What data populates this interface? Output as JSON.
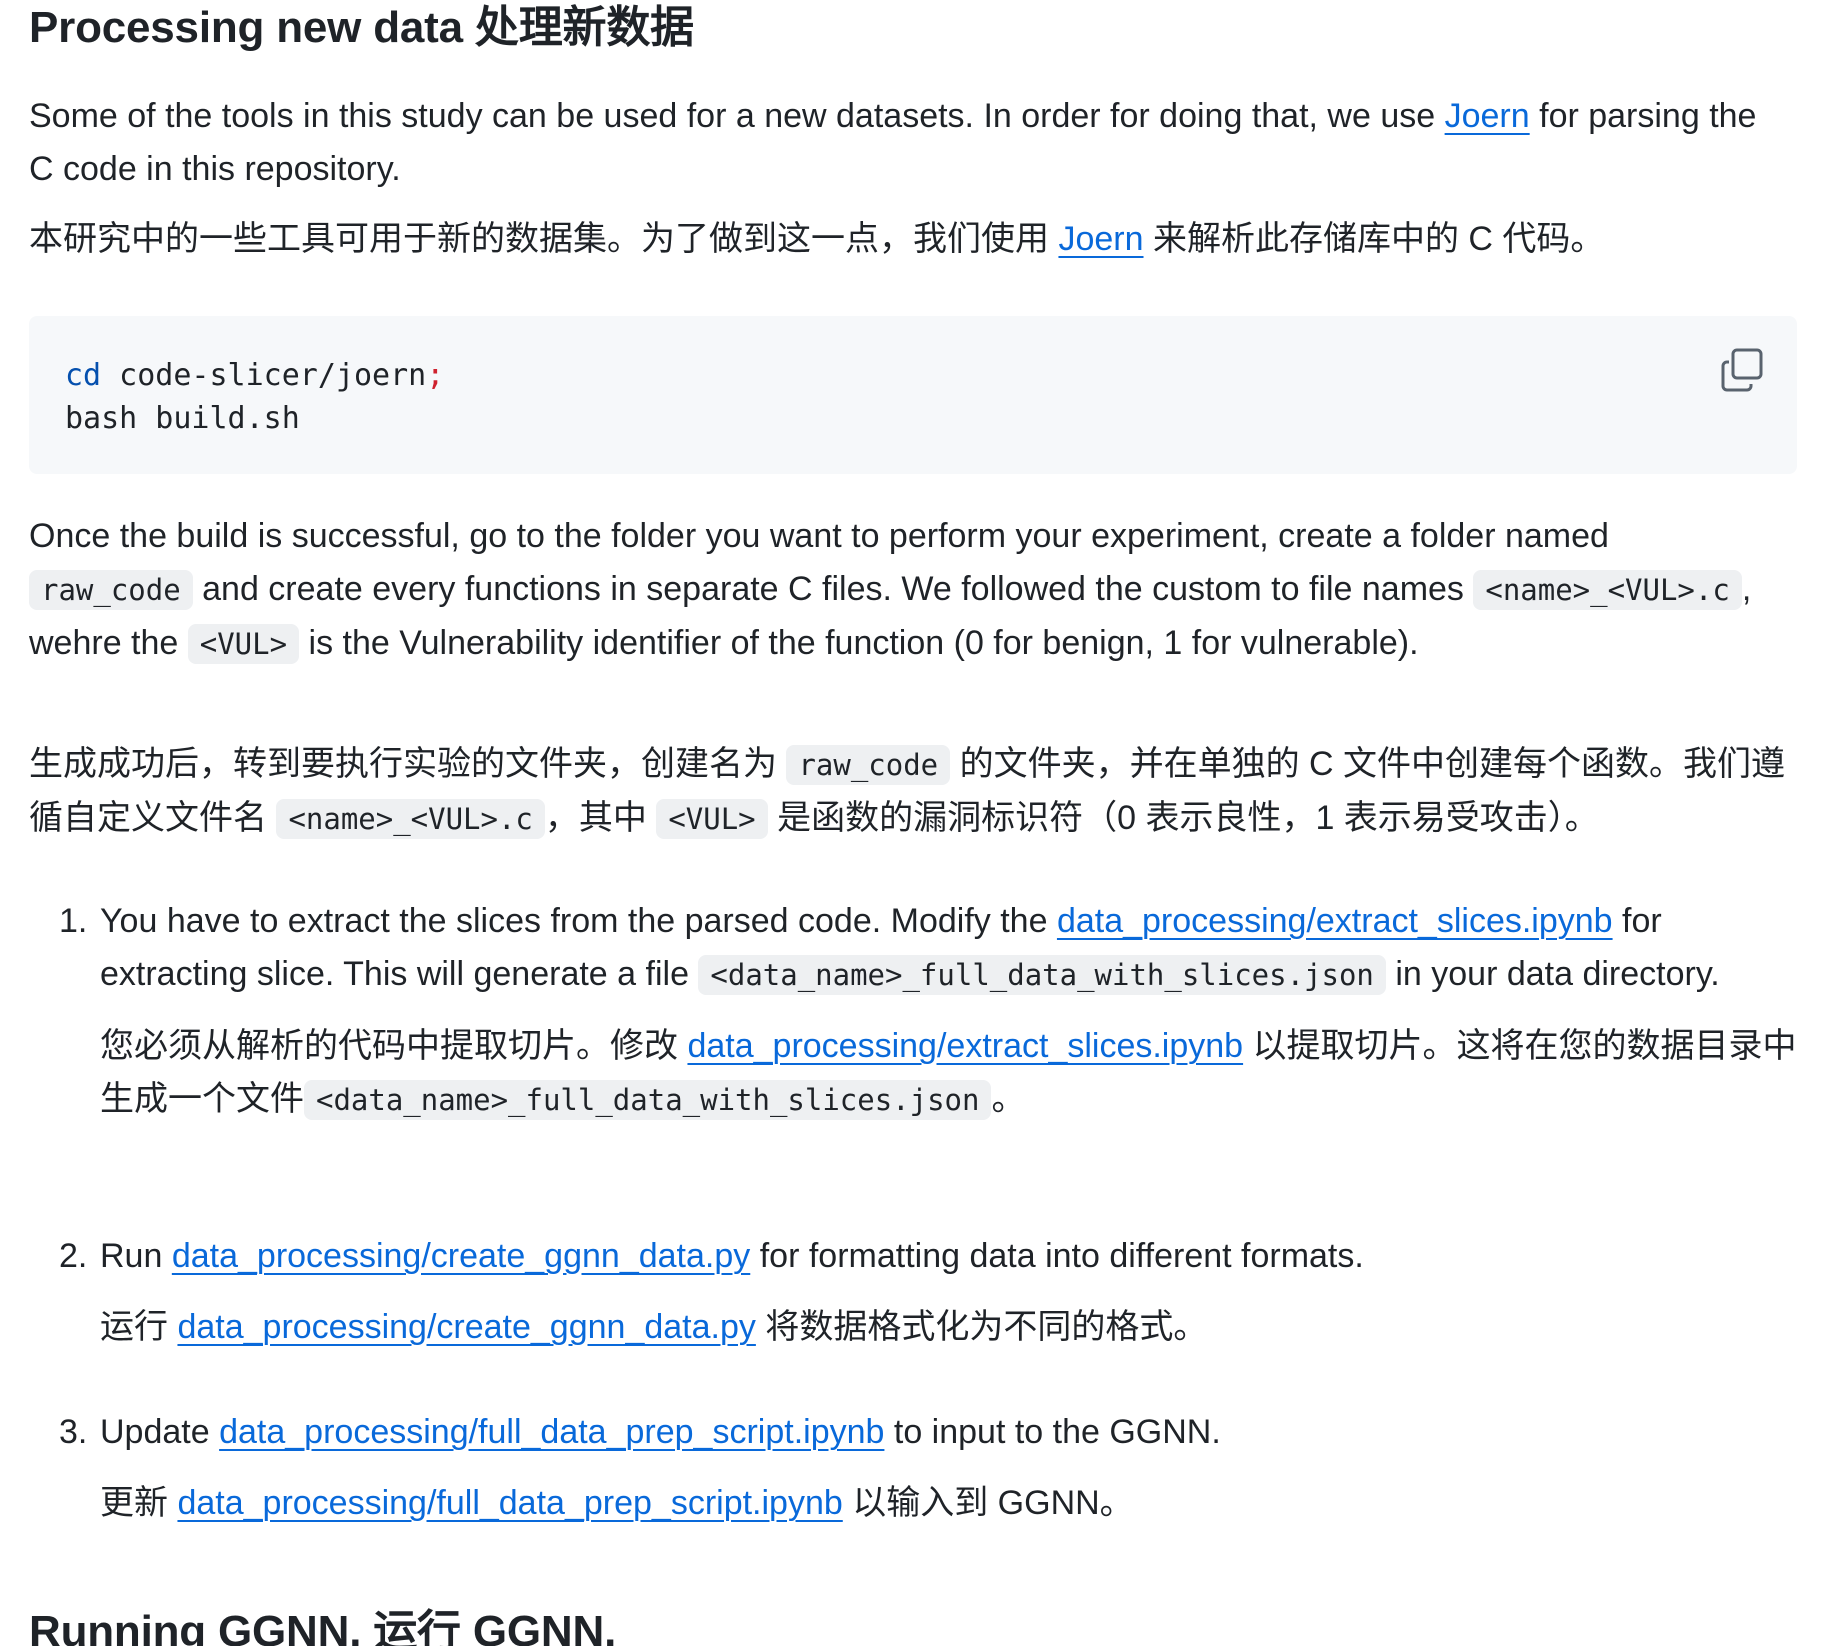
{
  "heading": "Processing new data 处理新数据",
  "intro": {
    "en_before": "Some of the tools in this study can be used for a new datasets. In order for doing that, we use ",
    "en_link": "Joern",
    "en_after": " for parsing the C code in this repository.",
    "zh_before": "本研究中的一些工具可用于新的数据集。为了做到这一点，我们使用 ",
    "zh_link": "Joern",
    "zh_after": " 来解析此存储库中的 C 代码。"
  },
  "code": {
    "line1_cmd": "cd",
    "line1_arg": " code-slicer/joern",
    "line1_semi": ";",
    "line2": "bash build.sh",
    "copy_icon": "copy-icon"
  },
  "build": {
    "en_1": "Once the build is successful, go to the folder you want to perform your experiment, create a folder named ",
    "en_code1": "raw_code",
    "en_2": " and create every functions in separate C files. We followed the custom to file names ",
    "en_code2": "<name>_<VUL>.c",
    "en_3": ", wehre the ",
    "en_code3": "<VUL>",
    "en_4": " is the Vulnerability identifier of the function (0 for benign, 1 for vulnerable).",
    "zh_1": "生成成功后，转到要执行实验的文件夹，创建名为 ",
    "zh_code1": "raw_code",
    "zh_2": " 的文件夹，并在单独的 C 文件中创建每个函数。我们遵循自定义文件名 ",
    "zh_code2": "<name>_<VUL>.c",
    "zh_3": "，其中 ",
    "zh_code3": "<VUL>",
    "zh_4": " 是函数的漏洞标识符（0 表示良性，1 表示易受攻击）。"
  },
  "steps": [
    {
      "num": "1.",
      "en_1": "You have to extract the slices from the parsed code. Modify the ",
      "en_link": "data_processing/extract_slices.ipynb",
      "en_2": " for extracting slice. This will generate a file ",
      "en_code": "<data_name>_full_data_with_slices.json",
      "en_3": " in your data directory.",
      "zh_1": "您必须从解析的代码中提取切片。修改 ",
      "zh_link": "data_processing/extract_slices.ipynb",
      "zh_2": " 以提取切片。这将在您的数据目录中生成一个文件",
      "zh_code": "<data_name>_full_data_with_slices.json",
      "zh_3": "。"
    },
    {
      "num": "2.",
      "en_1": "Run ",
      "en_link": "data_processing/create_ggnn_data.py",
      "en_2": " for formatting data into different formats.",
      "zh_1": "运行 ",
      "zh_link": "data_processing/create_ggnn_data.py",
      "zh_2": " 将数据格式化为不同的格式。"
    },
    {
      "num": "3.",
      "en_1": "Update ",
      "en_link": "data_processing/full_data_prep_script.ipynb",
      "en_2": " to input to the GGNN.",
      "zh_1": "更新 ",
      "zh_link": "data_processing/full_data_prep_script.ipynb",
      "zh_2": " 以输入到 GGNN。"
    }
  ],
  "next_heading": "Running GGNN. 运行 GGNN.",
  "colors": {
    "text": "#1f2328",
    "link": "#0969da",
    "code_bg": "#f6f8fa",
    "inline_code_bg": "#eef0f2",
    "keyword": "#0550ae",
    "punct": "#cf222e"
  }
}
